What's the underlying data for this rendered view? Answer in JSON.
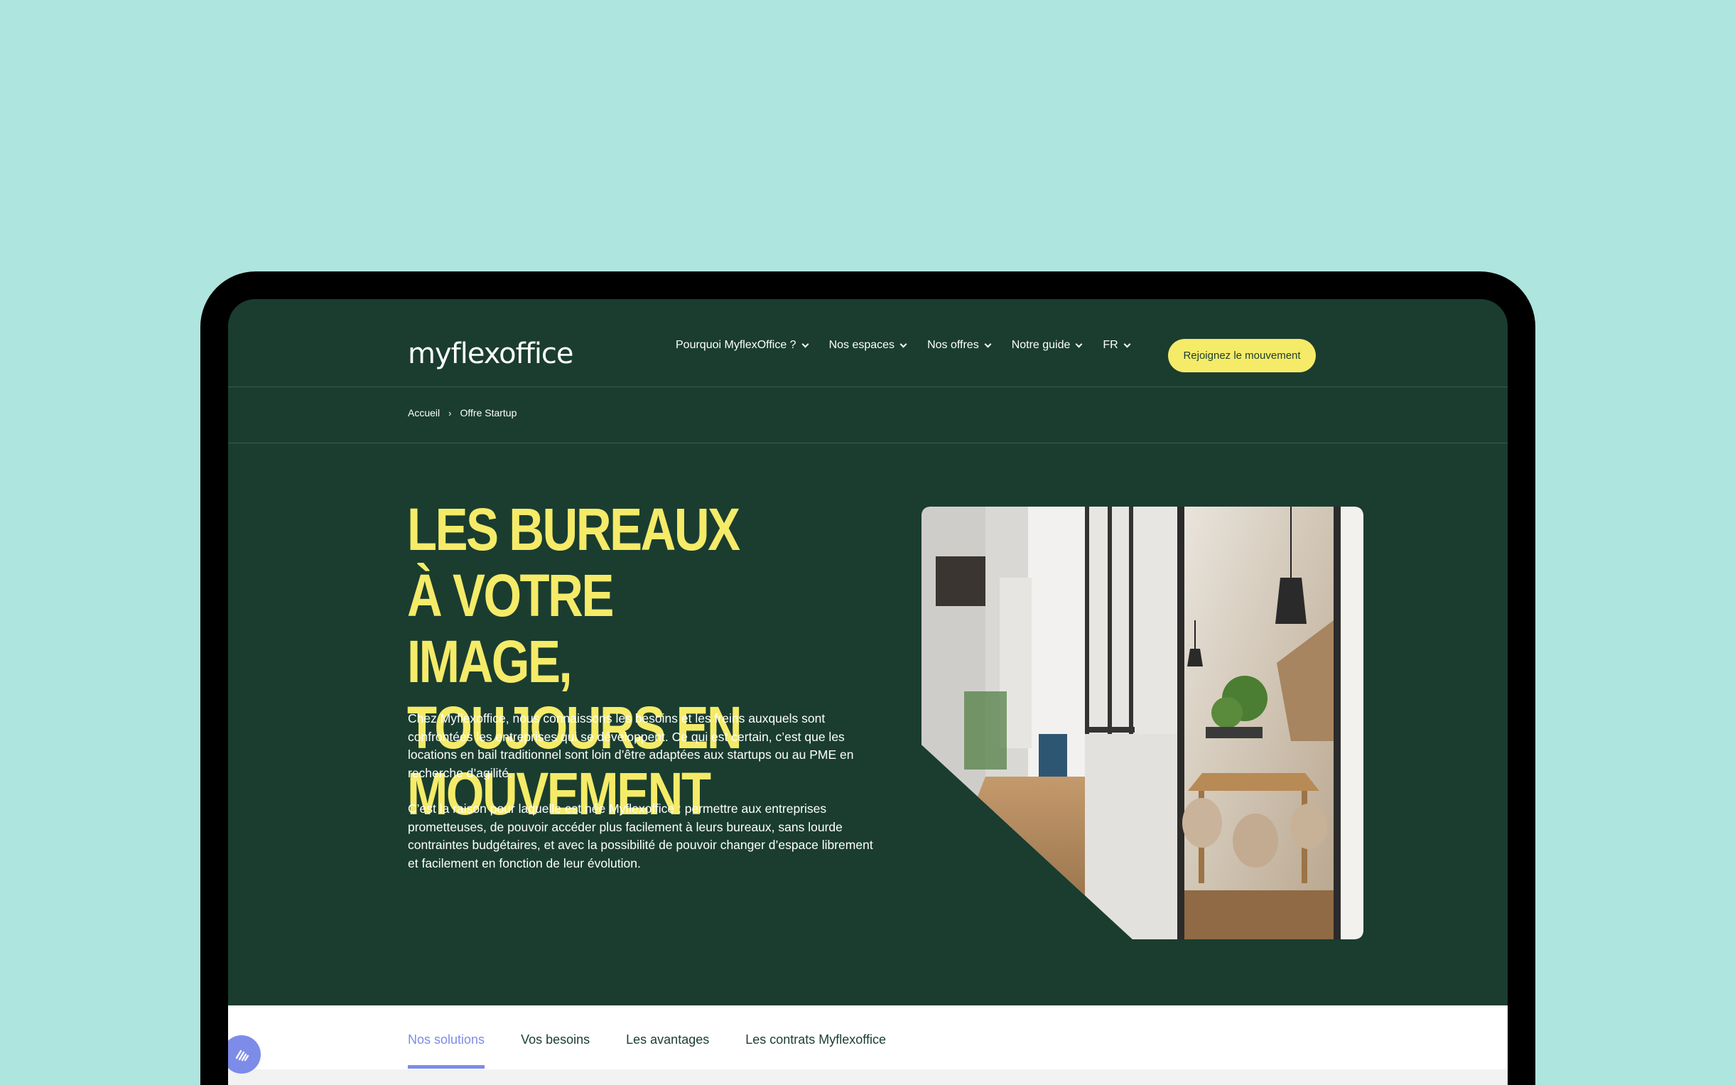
{
  "brand": {
    "logo_text": "myflexoffice"
  },
  "nav": {
    "items": [
      {
        "label": "Pourquoi MyflexOffice ?"
      },
      {
        "label": "Nos espaces"
      },
      {
        "label": "Nos offres"
      },
      {
        "label": "Notre guide"
      },
      {
        "label": "FR"
      }
    ],
    "cta": "Rejoignez le mouvement"
  },
  "breadcrumb": {
    "home": "Accueil",
    "separator": "›",
    "current": "Offre Startup"
  },
  "hero": {
    "title": "Les bureaux à votre image, toujours en mouvement",
    "paragraphs": [
      "Chez Myflexoffice, nous connaissons les besoins et les freins auxquels sont confrontées les entreprises qui se développent. Ce qui est certain, c’est que les locations en bail traditionnel sont loin d’être adaptées aux startups ou au PME en recherche d’agilité.",
      "C’est la raison pour laquelle est née Myflexoffice : permettre aux entreprises prometteuses, de pouvoir accéder plus facilement à leurs bureaux, sans lourde contraintes budgétaires, et avec la possibilité de pouvoir changer d’espace librement et facilement en fonction de leur évolution."
    ]
  },
  "tabs": [
    {
      "label": "Nos solutions",
      "active": true
    },
    {
      "label": "Vos besoins",
      "active": false
    },
    {
      "label": "Les avantages",
      "active": false
    },
    {
      "label": "Les contrats Myflexoffice",
      "active": false
    }
  ],
  "colors": {
    "page_bg": "#aee5de",
    "site_bg": "#1a3d30",
    "accent_yellow": "#f5eb68",
    "accent_blue": "#7d8ce8"
  }
}
